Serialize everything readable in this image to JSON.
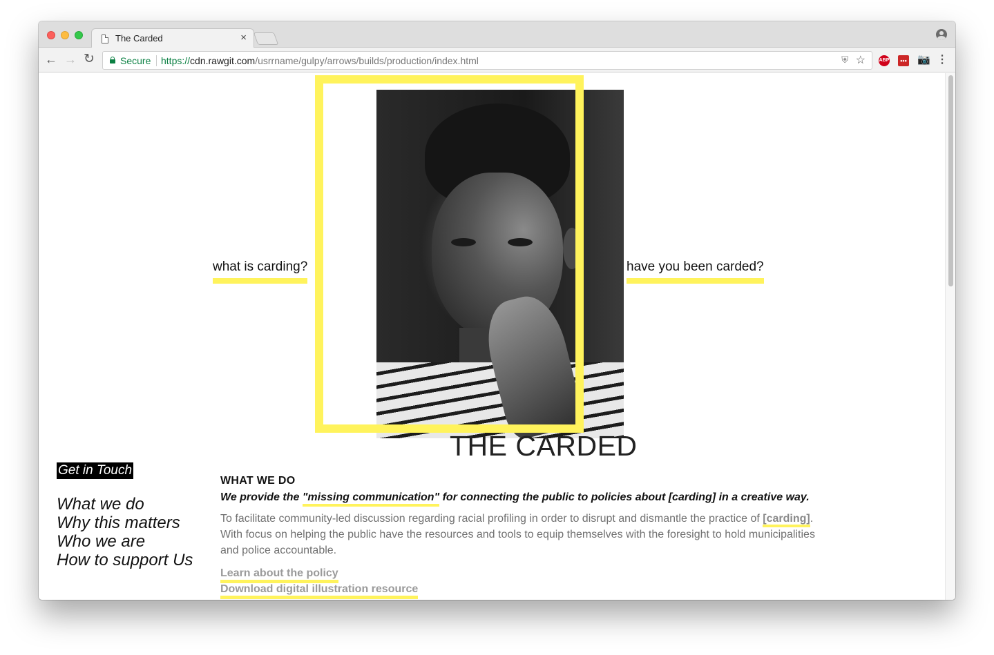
{
  "browser": {
    "tab_title": "The Carded",
    "tab_close": "×",
    "secure_label": "Secure",
    "url_scheme": "https://",
    "url_host": "cdn.rawgit.com",
    "url_path": "/usrrname/gulpy/arrows/builds/production/index.html",
    "nav_back": "←",
    "nav_forward": "→",
    "nav_reload": "↻",
    "star_glyph": "☆",
    "shield_glyph": "⛨",
    "ext_abp": "ABP",
    "ext_lastpass": "•••",
    "ext_camera": "📷",
    "menu_glyph": "⋮"
  },
  "hero": {
    "left_link": "what is carding?",
    "right_link": "have you been carded?",
    "title": "THE CARDED",
    "accent_color": "#fff35c"
  },
  "sidebar": {
    "contact": "Get in Touch",
    "items": [
      {
        "label": "What we do"
      },
      {
        "label": "Why this matters"
      },
      {
        "label": "Who we are"
      },
      {
        "label": "How to support Us"
      }
    ]
  },
  "main": {
    "heading": "WHAT WE DO",
    "tagline_pre": "We provide the ",
    "tagline_highlight": "\"missing communication\"",
    "tagline_post": " for connecting the public to policies about [carding] in a creative way.",
    "desc_part1": "To facilitate community-led discussion regarding racial profiling in order to disrupt and dismantle the practice of ",
    "desc_link": "[carding]",
    "desc_part2": ". With focus on helping the public have the resources and tools to equip themselves with the foresight to hold municipalities and police accountable.",
    "link_policy": "Learn about the policy",
    "link_download": "Download digital illustration resource"
  },
  "icons": {
    "page": "document-icon",
    "lock": "lock-icon",
    "profile": "profile-icon"
  }
}
